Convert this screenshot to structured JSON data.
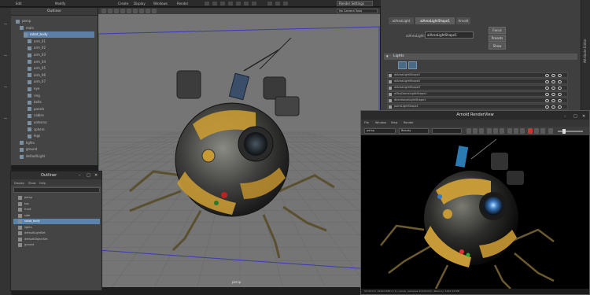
{
  "menubar": {
    "menus": [
      "Edit",
      "Modify",
      "Create",
      "Display",
      "Windows",
      "Render"
    ],
    "camera_field": "Render Settings",
    "right_menus": [
      "Edit",
      "Select",
      "Focus",
      "Attributes",
      "Show",
      "Help"
    ]
  },
  "left_outliner": {
    "title": "Outliner",
    "rows": [
      {
        "label": "persp",
        "indent": 0
      },
      {
        "label": "main",
        "indent": 1
      },
      {
        "label": "robot_body",
        "indent": 2
      },
      {
        "label": "arm_01",
        "indent": 3
      },
      {
        "label": "arm_02",
        "indent": 3
      },
      {
        "label": "arm_03",
        "indent": 3
      },
      {
        "label": "arm_04",
        "indent": 3
      },
      {
        "label": "arm_05",
        "indent": 3
      },
      {
        "label": "arm_06",
        "indent": 3
      },
      {
        "label": "arm_07",
        "indent": 3
      },
      {
        "label": "eye",
        "indent": 3
      },
      {
        "label": "ring",
        "indent": 3
      },
      {
        "label": "bolts",
        "indent": 3
      },
      {
        "label": "panels",
        "indent": 3
      },
      {
        "label": "cables",
        "indent": 3
      },
      {
        "label": "antenna",
        "indent": 3
      },
      {
        "label": "sphere",
        "indent": 3
      },
      {
        "label": "legs",
        "indent": 3
      },
      {
        "label": "lights",
        "indent": 1
      },
      {
        "label": "ground",
        "indent": 1
      },
      {
        "label": "defaultLight",
        "indent": 1
      }
    ],
    "selected_index": 2
  },
  "viewport": {
    "camera_label": "persp",
    "display_field": "No Camera Tools"
  },
  "right_panel": {
    "tabs": [
      "aiAreaLight",
      "aiAreaLightShape1",
      "Arnold"
    ],
    "active_tab": 1,
    "attr_label": "aiAreaLight:",
    "attr_value": "aiAreaLightShape1",
    "side_buttons": [
      "Focus",
      "Presets",
      "Show",
      "Hide"
    ],
    "lights_header": "Lights",
    "lights": [
      "aiAreaLightShape1",
      "aiAreaLightShape2",
      "aiAreaLightShape3",
      "aiSkyDomeLightShape1",
      "directionalLightShape1",
      "pointLightShape1"
    ],
    "side_label": "Attribute Editor"
  },
  "small_outliner": {
    "title": "Outliner",
    "menus": [
      "Display",
      "Show",
      "Help"
    ],
    "rows": [
      "persp",
      "top",
      "front",
      "side",
      "robot_body",
      "lights",
      "defaultLightSet",
      "defaultObjectSet",
      "ground"
    ],
    "selected_index": 4
  },
  "render_view": {
    "title": "Arnold RenderView",
    "menus": [
      "File",
      "Window",
      "View",
      "Render"
    ],
    "camera": "persp",
    "aov": "Beauty",
    "status": "00:00:12 | 1920x1080 (1:1) | persp | samples 3/2/2/2/2/2 | Memory: 1240.24 MB"
  }
}
